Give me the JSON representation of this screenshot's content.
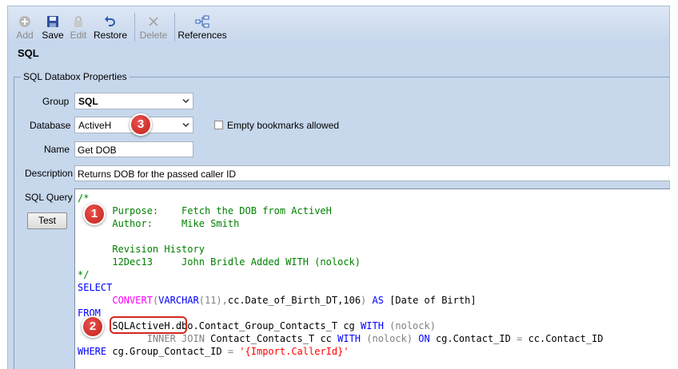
{
  "toolbar": {
    "add_label": "Add",
    "save_label": "Save",
    "edit_label": "Edit",
    "restore_label": "Restore",
    "delete_label": "Delete",
    "references_label": "References"
  },
  "header": {
    "title": "SQL"
  },
  "groupbox": {
    "legend": "SQL Databox Properties"
  },
  "form": {
    "group_label": "Group",
    "group_value": "SQL",
    "database_label": "Database",
    "database_value": "ActiveH",
    "empty_bookmarks_label": "Empty bookmarks allowed",
    "name_label": "Name",
    "name_value": "Get DOB",
    "description_label": "Description",
    "description_value": "Returns DOB for the passed caller ID",
    "sql_query_label": "SQL Query",
    "test_button_label": "Test"
  },
  "code": {
    "l1": "/*",
    "l2": "      Purpose:    Fetch the DOB from ActiveH",
    "l3": "      Author:     Mike Smith",
    "l5": "      Revision History",
    "l6": "      12Dec13     John Bridle Added WITH (nolock)",
    "l7": "*/",
    "l8": "SELECT",
    "l9a": "      ",
    "l9b": "CONVERT",
    "l9c": "(",
    "l9d": "VARCHAR",
    "l9e": "(11),",
    "l9f": "cc.Date_of_Birth_DT,106",
    "l9g": ")",
    "l9h": " AS ",
    "l9i": "[Date of Birth]",
    "l10": "FROM",
    "l11a": "      SQLActiveH.dbo.Contact_Group_Contacts_T cg ",
    "l11b": "WITH",
    "l11c": " (nolock)",
    "l12a": "            ",
    "l12b": "INNER JOIN",
    "l12c": " Contact_Contacts_T cc ",
    "l12d": "WITH",
    "l12e": " (nolock) ",
    "l12f": "ON",
    "l12g": " cg.Contact_ID ",
    "l12h": "=",
    "l12i": " cc.Contact_ID",
    "l13a": "WHERE",
    "l13b": " cg.Group_Contact_ID ",
    "l13c": "=",
    "l13d": " ",
    "l13e": "'{Import.CallerId}'"
  },
  "callouts": {
    "c1": "1",
    "c2": "2",
    "c3": "3"
  },
  "colors": {
    "badge": "#d1281f",
    "panel": "#c7d7ec",
    "comment": "#008000",
    "keyword": "#0000ff",
    "function": "#ff00ff",
    "string": "#ff0000"
  }
}
